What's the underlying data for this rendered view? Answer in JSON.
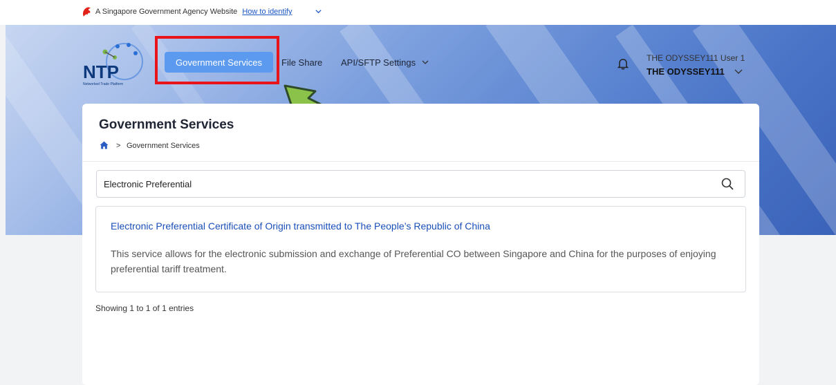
{
  "masthead": {
    "text": "A Singapore Government Agency Website",
    "link": "How to identify"
  },
  "logo": {
    "alt": "NTP",
    "subtitle": "Networked Trade Platform"
  },
  "nav": {
    "active": "Government Services",
    "file_share": "File Share",
    "api_settings": "API/SFTP Settings"
  },
  "user": {
    "name": "THE ODYSSEY111 User 1",
    "org": "THE ODYSSEY111"
  },
  "page": {
    "title": "Government Services",
    "breadcrumb": [
      "Government Services"
    ]
  },
  "search": {
    "value": "Electronic Preferential"
  },
  "results": [
    {
      "title": "Electronic Preferential Certificate of Origin transmitted to The People’s Republic of China",
      "description": "This service allows for the electronic submission and exchange of Preferential CO between Singapore and China for the purposes of enjoying preferential tariff treatment."
    }
  ],
  "pagination": {
    "summary": "Showing 1 to 1 of 1 entries"
  },
  "colors": {
    "accent": "#5c9af0",
    "link": "#1a4fb8",
    "highlight": "#e8141a",
    "arrow": "#8bc34a"
  }
}
